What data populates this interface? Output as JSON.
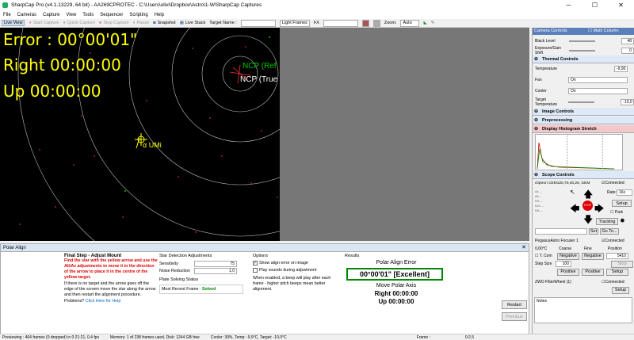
{
  "window": {
    "title": "SharpCap Pro (v4.1.13229, 64 bit) - AA269CPROTEC - C:\\Users\\olivi\\Dropbox\\Astro\\1-W\\SharpCap Captures",
    "minimize": "─",
    "maximize": "☐",
    "close": "✕"
  },
  "menu": [
    "File",
    "Cameras",
    "Capture",
    "View",
    "Tools",
    "Sequencer",
    "Scripting",
    "Help"
  ],
  "toolbar": {
    "live_view": "Live View",
    "start_capture": "Start Capture",
    "quick_capture": "Quick Capture",
    "stop_capture": "Stop Capture",
    "pause": "Pause",
    "snapshot": "Snapshot",
    "live_stack": "Live Stack",
    "target_name_label": "Target Name :",
    "frame_type": "Light Frames",
    "fx_label": "FX",
    "zoom_label": "Zoom:",
    "zoom_value": "Auto"
  },
  "overlay": {
    "error": "Error : 00°00'01\"",
    "right": "Right 00:00:00",
    "up": "Up 00:00:00",
    "ncp_ref": "NCP (Ref",
    "ncp_true": "NCP (True",
    "star": "α UMi"
  },
  "polar_align": {
    "panel_title": "Polar Align",
    "step_title": "Final Step - Adjust Mount",
    "instruction_red": "Find the star with the yellow arrow and use the Alt/Az adjustments to move it in the direction of the arrow to place it in the centre of the yellow target.",
    "instruction_2": "If there is no target and the arrow goes off the edge of the screen move the star along the arrow and then restart the alignment procedure.",
    "problems": "Problems?",
    "help_link": "Click Here for Help",
    "star_detect_title": "Star Detection Adjustments",
    "sensitivity_label": "Sensitivity",
    "sensitivity_value": "75",
    "noise_label": "Noise Reduction",
    "noise_value": "1,0",
    "solving_title": "Plate Solving Status",
    "recent_frame_label": "Most Recent Frame :",
    "recent_frame_value": "Solved",
    "options_title": "Options",
    "opt1": "Show align error on image",
    "opt2": "Play sounds during adjustment",
    "opt_note": "When enabled, a beep will play after each frame - higher pitch beeps mean better alignment.",
    "results_title": "Results",
    "pae_label": "Polar Align Error",
    "pae_value": "00°00'01\" [Excellent]",
    "move_label": "Move Polar Axis",
    "right": "Right 00:00:00",
    "up": "Up 00:00:00",
    "restart": "Restart",
    "previous": "Previous"
  },
  "camera_controls": {
    "title": "Camera Controls",
    "multi_column": "Multi Column",
    "black_level_label": "Black Level",
    "black_level_value": "48",
    "exposure_label": "Exposure/Gain Shift",
    "exposure_value": "0",
    "thermal_title": "Thermal Controls",
    "temperature_label": "Temperature",
    "temperature_value": "-9,90",
    "fan_label": "Fan",
    "fan_value": "On",
    "cooler_label": "Cooler",
    "cooler_value": "On",
    "target_temp_label": "Target Temperature",
    "target_temp_value": "-10,0",
    "image_controls": "Image Controls",
    "preprocessing": "Preprocessing",
    "histogram": "Display Histogram Stretch",
    "scope_controls": "Scope Controls",
    "mount": "iOptron CEM120,70,40,26, GEM",
    "connected": "Connected",
    "rate_label": "Rate:",
    "rate_value": "16x",
    "setup": "Setup",
    "park": "Park",
    "tracking": "Tracking",
    "stop": "STOP",
    "set": "Set",
    "goto": "Go To...",
    "focuser": "PegasusAstro Focuser 1",
    "focuser_temp": "0,00°C",
    "coarse": "Coarse",
    "fine": "Fine",
    "position": "Position",
    "tcomp": "T. Com",
    "negative": "Negative",
    "position_value": "5410",
    "step_size_label": "Step Size",
    "step_size_value": "100",
    "stop2": "Stop",
    "positive": "Positive",
    "filterwheel": "ZWO FilterWheel (1)",
    "notes": "Notes"
  },
  "status": {
    "preview": "Previewing : 464 frames (0 dropped) in 0:21:21, 0,4 fps",
    "memory": "Memory: 1 of 238 frames used, Disk: 1244 GB free",
    "cooler": "Cooler: 39%, Temp: -9,9°C, Target: -10,0°C",
    "frame": "Frame :",
    "zoom": "0:2,5"
  }
}
